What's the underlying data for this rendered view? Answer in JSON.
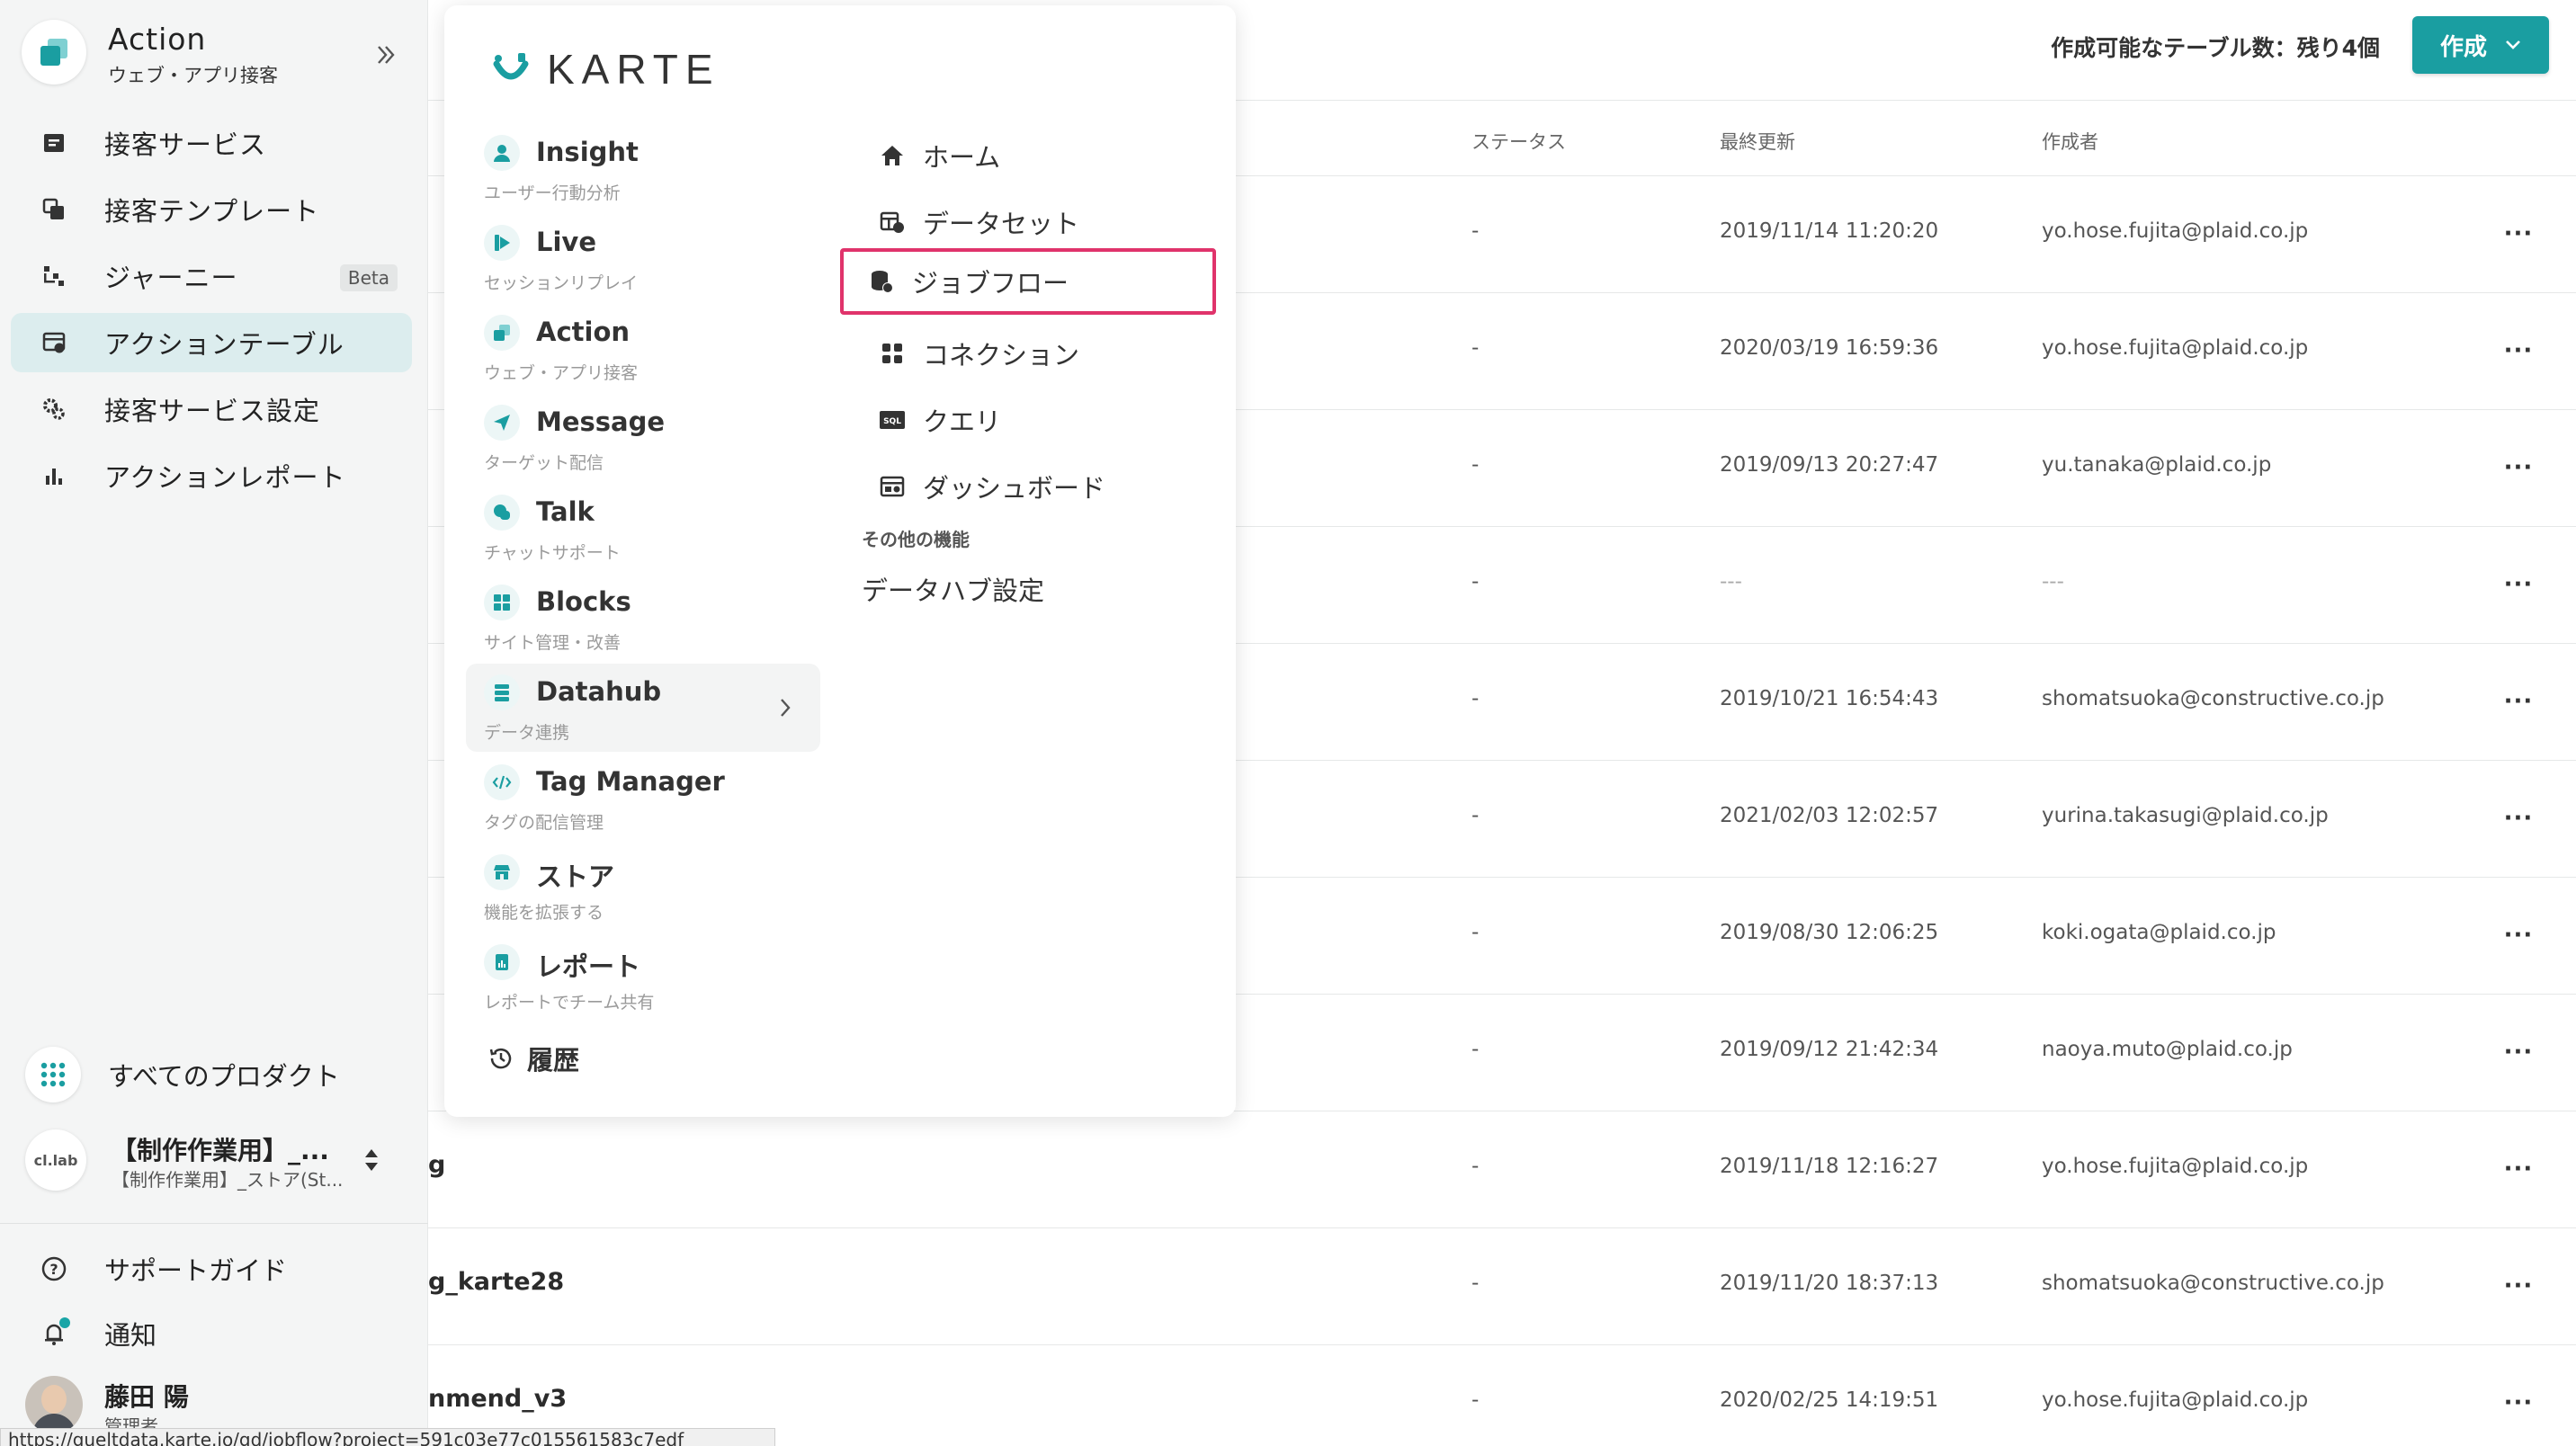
{
  "sidebar": {
    "app_title": "Action",
    "app_subtitle": "ウェブ・アプリ接客",
    "nav": [
      {
        "label": "接客サービス",
        "icon": "service-icon"
      },
      {
        "label": "接客テンプレート",
        "icon": "template-icon"
      },
      {
        "label": "ジャーニー",
        "icon": "journey-icon",
        "badge": "Beta"
      },
      {
        "label": "アクションテーブル",
        "icon": "action-table-icon",
        "active": true
      },
      {
        "label": "接客サービス設定",
        "icon": "settings-gear-icon"
      },
      {
        "label": "アクションレポート",
        "icon": "bar-chart-icon"
      }
    ],
    "all_products": "すべてのプロダクト",
    "project_avatar": "cl.lab",
    "project_name": "【制作作業用】_...",
    "project_sub": "【制作作業用】_ストア(St...",
    "support_guide": "サポートガイド",
    "notifications": "通知",
    "user_name": "藤田 陽",
    "user_role": "管理者"
  },
  "topbar": {
    "remaining": "作成可能なテーブル数：残り4個",
    "create_button": "作成"
  },
  "table": {
    "headers": {
      "status": "ステータス",
      "updated": "最終更新",
      "author": "作成者"
    },
    "rows": [
      {
        "name": "",
        "status": "-",
        "updated": "2019/11/14 11:20:20",
        "author": "yo.hose.fujita@plaid.co.jp"
      },
      {
        "name": "",
        "status": "-",
        "updated": "2020/03/19 16:59:36",
        "author": "yo.hose.fujita@plaid.co.jp"
      },
      {
        "name": "",
        "status": "-",
        "updated": "2019/09/13 20:27:47",
        "author": "yu.tanaka@plaid.co.jp"
      },
      {
        "name": "",
        "status": "-",
        "updated": "---",
        "author": "---"
      },
      {
        "name": "",
        "status": "-",
        "updated": "2019/10/21 16:54:43",
        "author": "shomatsuoka@constructive.co.jp"
      },
      {
        "name": "",
        "status": "-",
        "updated": "2021/02/03 12:02:57",
        "author": "yurina.takasugi@plaid.co.jp"
      },
      {
        "name": "",
        "status": "-",
        "updated": "2019/08/30 12:06:25",
        "author": "koki.ogata@plaid.co.jp"
      },
      {
        "name": "",
        "status": "-",
        "updated": "2019/09/12 21:42:34",
        "author": "naoya.muto@plaid.co.jp"
      },
      {
        "name": "g",
        "status": "-",
        "updated": "2019/11/18 12:16:27",
        "author": "yo.hose.fujita@plaid.co.jp"
      },
      {
        "name": "g_karte28",
        "status": "-",
        "updated": "2019/11/20 18:37:13",
        "author": "shomatsuoka@constructive.co.jp"
      },
      {
        "name": "nmend_v3",
        "status": "-",
        "updated": "2020/02/25 14:19:51",
        "author": "yo.hose.fujita@plaid.co.jp"
      }
    ],
    "row_menu": "···"
  },
  "menu": {
    "logo_text": "KARTE",
    "products": [
      {
        "name": "Insight",
        "desc": "ユーザー行動分析",
        "icon": "user-icon"
      },
      {
        "name": "Live",
        "desc": "セッションリプレイ",
        "icon": "live-play-icon"
      },
      {
        "name": "Action",
        "desc": "ウェブ・アプリ接客",
        "icon": "action-icon"
      },
      {
        "name": "Message",
        "desc": "ターゲット配信",
        "icon": "paper-plane-icon"
      },
      {
        "name": "Talk",
        "desc": "チャットサポート",
        "icon": "chat-bubble-icon"
      },
      {
        "name": "Blocks",
        "desc": "サイト管理・改善",
        "icon": "blocks-icon"
      },
      {
        "name": "Datahub",
        "desc": "データ連携",
        "icon": "database-icon",
        "active": true
      },
      {
        "name": "Tag Manager",
        "desc": "タグの配信管理",
        "icon": "code-icon"
      },
      {
        "name": "ストア",
        "desc": "機能を拡張する",
        "icon": "store-icon"
      },
      {
        "name": "レポート",
        "desc": "レポートでチーム共有",
        "icon": "report-icon"
      }
    ],
    "history": "履歴",
    "datahub_items": [
      {
        "label": "ホーム",
        "icon": "home-icon"
      },
      {
        "label": "データセット",
        "icon": "dataset-icon"
      },
      {
        "label": "ジョブフロー",
        "icon": "jobflow-icon",
        "highlight": true
      },
      {
        "label": "コネクション",
        "icon": "connection-icon"
      },
      {
        "label": "クエリ",
        "icon": "sql-icon"
      },
      {
        "label": "ダッシュボード",
        "icon": "dashboard-icon"
      }
    ],
    "other_heading": "その他の機能",
    "datahub_settings": "データハブ設定"
  },
  "status_url": "https://gueltdata.karte.io/gd/jobflow?project=591c03e77c015561583c7edf",
  "colors": {
    "accent": "#1a9ea1",
    "highlight": "#e0336b",
    "active_bg": "#dcedee"
  }
}
